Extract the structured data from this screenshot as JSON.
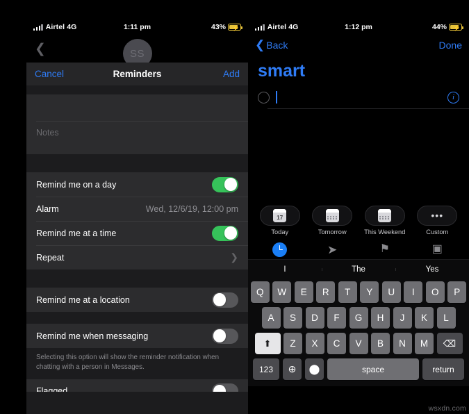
{
  "left_phone": {
    "status_bar": {
      "carrier": "Airtel 4G",
      "time": "1:11 pm",
      "battery": "43%",
      "signal_icon": "signal-bars-icon",
      "battery_icon": "battery-charging-icon"
    },
    "avatar": {
      "initials": "SS",
      "back_icon": "back-chevron-icon"
    },
    "navbar": {
      "cancel_label": "Cancel",
      "title": "Reminders",
      "add_label": "Add"
    },
    "fields": {
      "title_value": "",
      "notes_placeholder": "Notes"
    },
    "rows": [
      {
        "label": "Remind me on a day",
        "type": "toggle",
        "state": "on"
      },
      {
        "label": "Alarm",
        "type": "value",
        "value": "Wed, 12/6/19, 12:00 pm"
      },
      {
        "label": "Remind me at a time",
        "type": "toggle",
        "state": "on"
      },
      {
        "label": "Repeat",
        "type": "disclosure",
        "chevron": "chevron-right-icon"
      },
      {
        "label": "Remind me at a location",
        "type": "toggle",
        "state": "off"
      },
      {
        "label": "Remind me when messaging",
        "type": "toggle",
        "state": "off"
      }
    ],
    "footnote": "Selecting this option will show the reminder notification when chatting with a person in Messages.",
    "clipped_row": {
      "label": "Flagged",
      "state": "off"
    }
  },
  "right_phone": {
    "status_bar": {
      "carrier": "Airtel 4G",
      "time": "1:12 pm",
      "battery": "44%",
      "signal_icon": "signal-bars-icon",
      "battery_icon": "battery-charging-icon"
    },
    "navbar": {
      "back_label": "Back",
      "done_label": "Done",
      "back_icon": "back-chevron-icon"
    },
    "list_title": "smart",
    "new_item": {
      "value": "",
      "circle_icon": "empty-circle-icon",
      "info_icon": "info-circle-icon",
      "info_glyph": "i"
    },
    "quick_actions": [
      {
        "label": "Today",
        "icon": "calendar-today-icon",
        "badge": "17"
      },
      {
        "label": "Tomorrow",
        "icon": "calendar-tomorrow-icon",
        "badge": ""
      },
      {
        "label": "This Weekend",
        "icon": "calendar-weekend-icon",
        "badge": ""
      },
      {
        "label": "Custom",
        "icon": "ellipsis-icon",
        "badge": "•••"
      }
    ],
    "attribute_icons": [
      {
        "name": "clock-icon",
        "state": "active"
      },
      {
        "name": "location-arrow-icon",
        "glyph": "➤",
        "state": "inactive"
      },
      {
        "name": "flag-icon",
        "glyph": "⚑",
        "state": "inactive"
      },
      {
        "name": "camera-icon",
        "glyph": "▣",
        "state": "inactive"
      }
    ],
    "keyboard": {
      "predictions": [
        "I",
        "The",
        "Yes"
      ],
      "row1": [
        "Q",
        "W",
        "E",
        "R",
        "T",
        "Y",
        "U",
        "I",
        "O",
        "P"
      ],
      "row2": [
        "A",
        "S",
        "D",
        "F",
        "G",
        "H",
        "J",
        "K",
        "L"
      ],
      "row3": [
        "Z",
        "X",
        "C",
        "V",
        "B",
        "N",
        "M"
      ],
      "shift_label": "⬆",
      "backspace_label": "⌫",
      "numbers_label": "123",
      "globe_label": "⊕",
      "mic_label": "⬤",
      "space_label": "space",
      "return_label": "return"
    }
  },
  "watermark": "wsxdn.com",
  "colors": {
    "accent_blue": "#2f7cf6",
    "toggle_on": "#36c25a",
    "toggle_off": "#57575a",
    "row_bg": "#2c2c2e",
    "page_bg": "#1c1c1e",
    "battery_yellow": "#e8c33a"
  }
}
